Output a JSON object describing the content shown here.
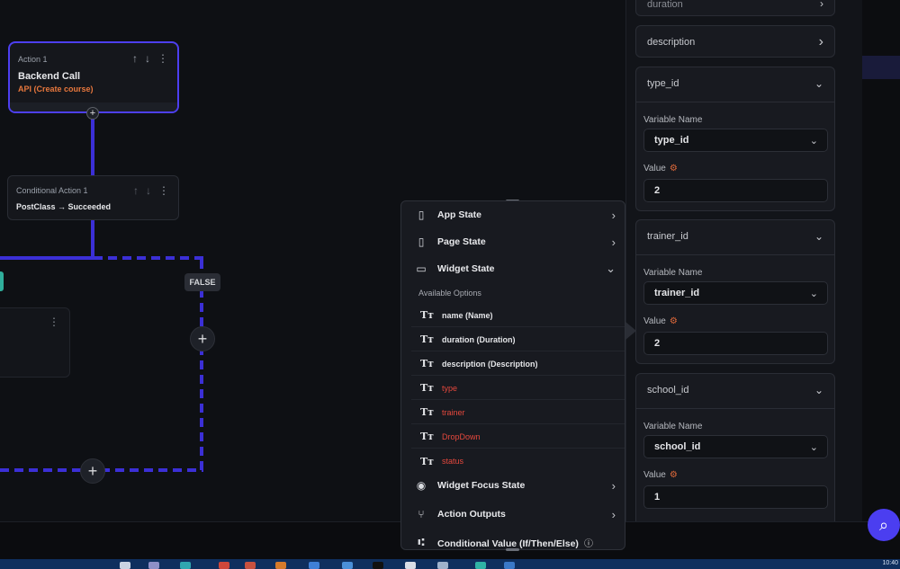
{
  "canvas": {
    "action_card": {
      "small_label": "Action 1",
      "title": "Backend Call",
      "subtitle": "API (Create course)"
    },
    "conditional_card": {
      "small_label": "Conditional Action 1",
      "title": "PostClass → Succeeded"
    },
    "false_badge": "FALSE"
  },
  "right_panel": {
    "top_cut_label": "duration",
    "description_label": "description",
    "sections": [
      {
        "header": "type_id",
        "variable_name_label": "Variable Name",
        "variable_name_value": "type_id",
        "value_label": "Value",
        "value": "2"
      },
      {
        "header": "trainer_id",
        "variable_name_label": "Variable Name",
        "variable_name_value": "trainer_id",
        "value_label": "Value",
        "value": "2"
      },
      {
        "header": "school_id",
        "variable_name_label": "Variable Name",
        "variable_name_value": "school_id",
        "value_label": "Value",
        "value": "1"
      }
    ]
  },
  "popup": {
    "items": {
      "app_state": "App State",
      "page_state": "Page State",
      "widget_state": "Widget State",
      "widget_focus_state": "Widget Focus State",
      "action_outputs": "Action Outputs",
      "conditional_value": "Conditional Value (If/Then/Else)"
    },
    "available_options_label": "Available Options",
    "options": [
      {
        "label": "name (Name)",
        "error": false
      },
      {
        "label": "duration (Duration)",
        "error": false
      },
      {
        "label": "description (Description)",
        "error": false
      },
      {
        "label": "type",
        "error": true
      },
      {
        "label": "trainer",
        "error": true
      },
      {
        "label": "DropDown",
        "error": true
      },
      {
        "label": "status",
        "error": true
      }
    ]
  },
  "taskbar": {
    "clock": "10:40"
  },
  "colors": {
    "flow_line": "#3b2fd6",
    "accent": "#4b3ef0",
    "error_text": "#e5483d",
    "api_text": "#e7773d"
  },
  "icons": {
    "app_state": "mobile-icon",
    "page_state": "page-icon",
    "widget_state": "widget-icon",
    "widget_focus_state": "eye-icon",
    "action_outputs": "branch-icon",
    "conditional_value": "conditional-icon",
    "option_type": "text-type-icon"
  }
}
